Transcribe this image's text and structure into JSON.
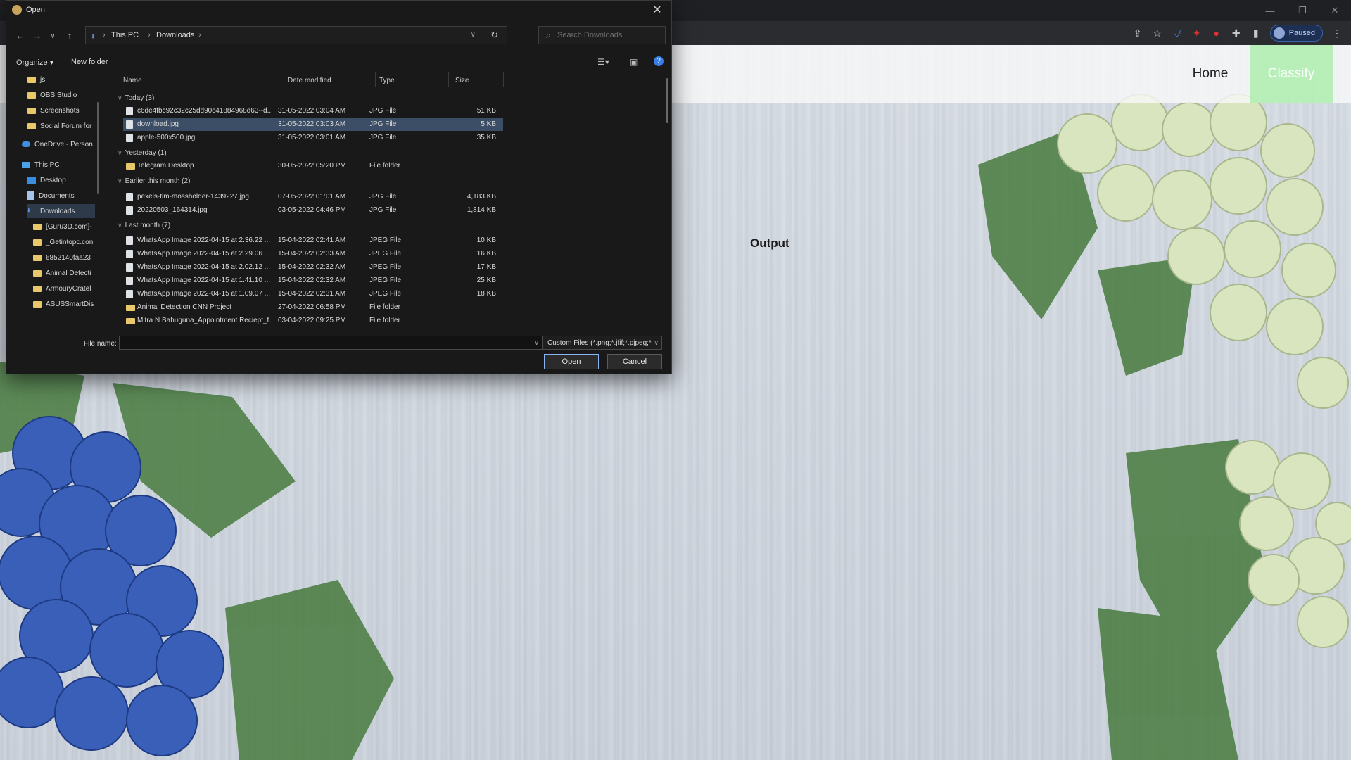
{
  "browser": {
    "window_controls": [
      "—",
      "❐",
      "✕"
    ],
    "paused_label": "Paused",
    "extension_icons": [
      "share-icon",
      "star-icon",
      "shield-icon",
      "tp-icon",
      "red-circle-icon",
      "puzzle-icon",
      "sidebar-icon"
    ],
    "menu_glyph": "⋮"
  },
  "webpage": {
    "nav": {
      "home": "Home",
      "classify": "Classify"
    },
    "output_label": "Output",
    "colors": {
      "classify_bg": "#a4eca4",
      "navbar_bg": "#f8f8f8"
    }
  },
  "dialog": {
    "title": "Open",
    "close_glyph": "✕",
    "address": {
      "crumbs": [
        "This PC",
        "Downloads"
      ],
      "sep": "›"
    },
    "search_placeholder": "Search Downloads",
    "commands": {
      "organize": "Organize ▾",
      "new_folder": "New folder"
    },
    "help_glyph": "?",
    "nav_pane": [
      {
        "label": "js",
        "icon": "folder-icon"
      },
      {
        "label": "OBS Studio",
        "icon": "folder-icon"
      },
      {
        "label": "Screenshots",
        "icon": "folder-icon"
      },
      {
        "label": "Social Forum for",
        "icon": "folder-icon"
      },
      {
        "label": "OneDrive - Person",
        "icon": "cloud-icon"
      },
      {
        "label": "This PC",
        "icon": "pc-icon"
      },
      {
        "label": "Desktop",
        "icon": "desktop-icon"
      },
      {
        "label": "Documents",
        "icon": "documents-icon"
      },
      {
        "label": "Downloads",
        "icon": "download-icon",
        "selected": true
      },
      {
        "label": "[Guru3D.com]-",
        "icon": "folder-icon"
      },
      {
        "label": "_Getintopc.con",
        "icon": "folder-icon"
      },
      {
        "label": "6852140faa23",
        "icon": "folder-icon"
      },
      {
        "label": "Animal Detecti",
        "icon": "folder-icon"
      },
      {
        "label": "ArmouryCratel",
        "icon": "folder-icon"
      },
      {
        "label": "ASUSSmartDis",
        "icon": "folder-icon"
      }
    ],
    "columns": {
      "name": "Name",
      "date": "Date modified",
      "type": "Type",
      "size": "Size"
    },
    "groups": [
      {
        "label": "Today (3)",
        "files": [
          {
            "name": "c6de4fbc92c32c25dd90c41884968d63--d...",
            "date": "31-05-2022 03:04 AM",
            "type": "JPG File",
            "size": "51 KB",
            "folder": false
          },
          {
            "name": "download.jpg",
            "date": "31-05-2022 03:03 AM",
            "type": "JPG File",
            "size": "5 KB",
            "folder": false,
            "selected": true
          },
          {
            "name": "apple-500x500.jpg",
            "date": "31-05-2022 03:01 AM",
            "type": "JPG File",
            "size": "35 KB",
            "folder": false
          }
        ]
      },
      {
        "label": "Yesterday (1)",
        "files": [
          {
            "name": "Telegram Desktop",
            "date": "30-05-2022 05:20 PM",
            "type": "File folder",
            "size": "",
            "folder": true
          }
        ]
      },
      {
        "label": "Earlier this month (2)",
        "files": [
          {
            "name": "pexels-tim-mossholder-1439227.jpg",
            "date": "07-05-2022 01:01 AM",
            "type": "JPG File",
            "size": "4,183 KB",
            "folder": false
          },
          {
            "name": "20220503_164314.jpg",
            "date": "03-05-2022 04:46 PM",
            "type": "JPG File",
            "size": "1,814 KB",
            "folder": false
          }
        ]
      },
      {
        "label": "Last month (7)",
        "files": [
          {
            "name": "WhatsApp Image 2022-04-15 at 2.36.22 ...",
            "date": "15-04-2022 02:41 AM",
            "type": "JPEG File",
            "size": "10 KB",
            "folder": false
          },
          {
            "name": "WhatsApp Image 2022-04-15 at 2.29.06 ...",
            "date": "15-04-2022 02:33 AM",
            "type": "JPEG File",
            "size": "16 KB",
            "folder": false
          },
          {
            "name": "WhatsApp Image 2022-04-15 at 2.02.12 ...",
            "date": "15-04-2022 02:32 AM",
            "type": "JPEG File",
            "size": "17 KB",
            "folder": false
          },
          {
            "name": "WhatsApp Image 2022-04-15 at 1.41.10 ...",
            "date": "15-04-2022 02:32 AM",
            "type": "JPEG File",
            "size": "25 KB",
            "folder": false
          },
          {
            "name": "WhatsApp Image 2022-04-15 at 1.09.07 ...",
            "date": "15-04-2022 02:31 AM",
            "type": "JPEG File",
            "size": "18 KB",
            "folder": false
          },
          {
            "name": "Animal Detection CNN Project",
            "date": "27-04-2022 06:58 PM",
            "type": "File folder",
            "size": "",
            "folder": true
          },
          {
            "name": "Mitra N Bahuguna_Appointment Reciept_f...",
            "date": "03-04-2022 09:25 PM",
            "type": "File folder",
            "size": "",
            "folder": true
          }
        ]
      }
    ],
    "file_name_label": "File name:",
    "file_name_value": "",
    "file_type_filter": "Custom Files (*.png;*.jfif;*.pjpeg;*",
    "open_button": "Open",
    "cancel_button": "Cancel"
  }
}
